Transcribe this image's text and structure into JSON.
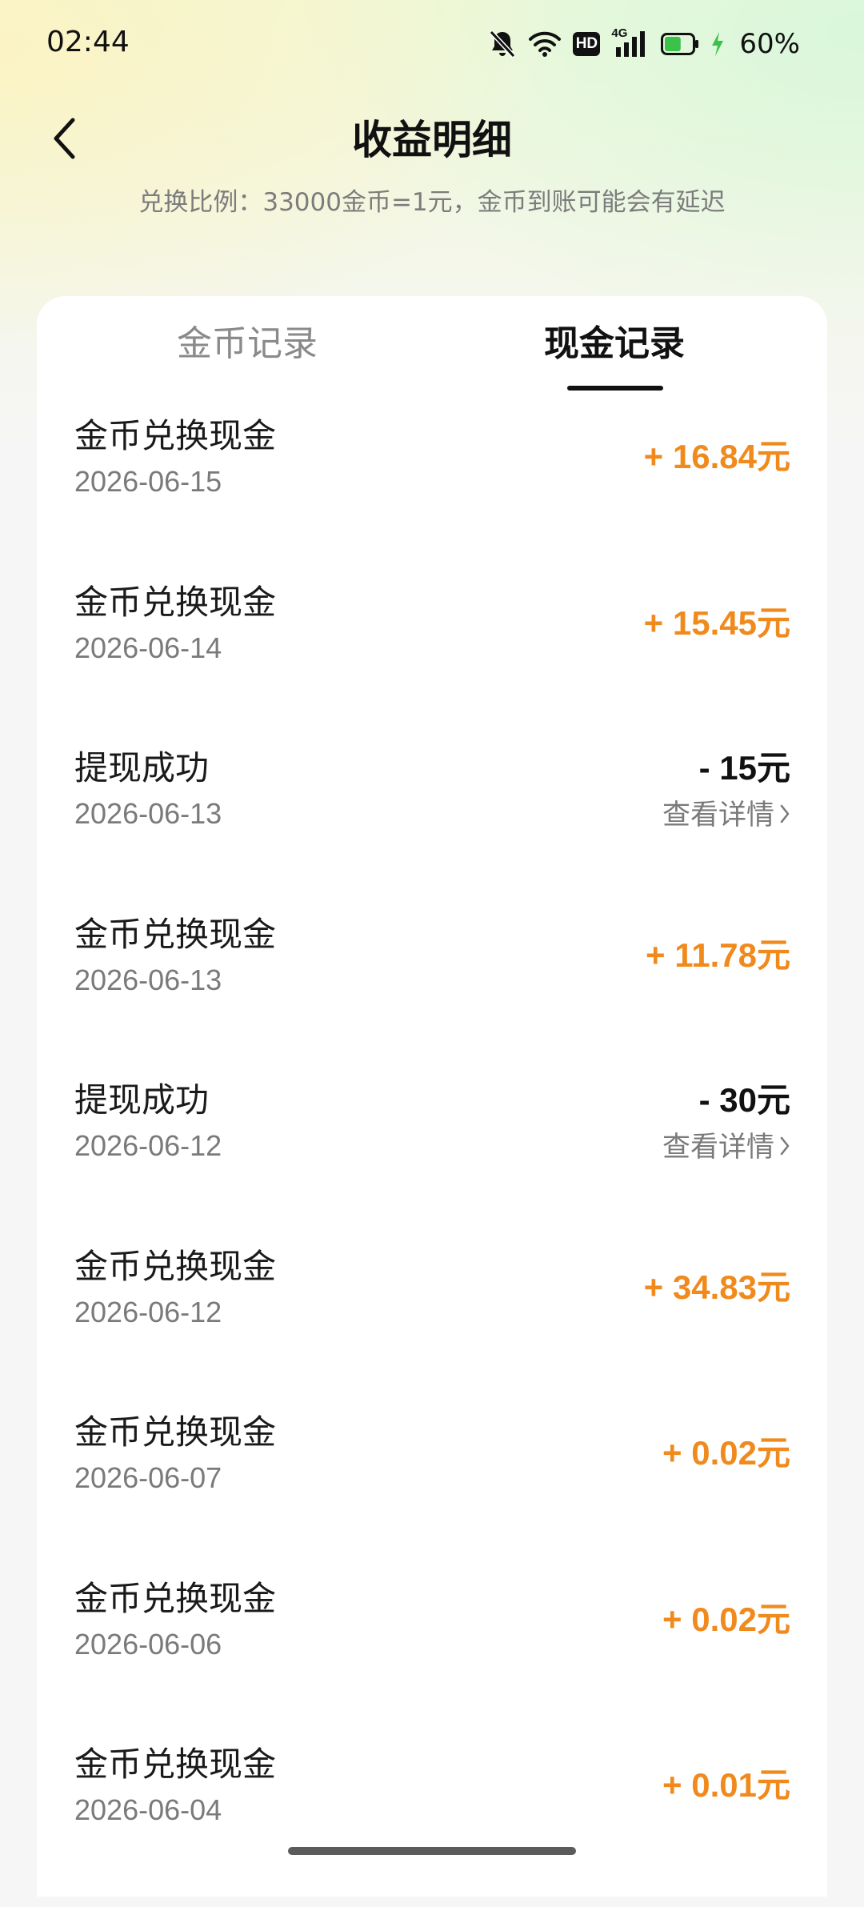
{
  "status_bar": {
    "time": "02:44",
    "network": "4G",
    "hd": "HD",
    "battery_percent": "60%",
    "battery_level": 0.6
  },
  "header": {
    "title": "收益明细",
    "subtitle": "兑换比例：33000金币=1元，金币到账可能会有延迟"
  },
  "tabs": [
    {
      "label": "金币记录",
      "active": false
    },
    {
      "label": "现金记录",
      "active": true
    }
  ],
  "records": [
    {
      "title": "金币兑换现金",
      "date": "2026-06-15",
      "amount": "+ 16.84",
      "unit": "元",
      "type": "income"
    },
    {
      "title": "金币兑换现金",
      "date": "2026-06-14",
      "amount": "+ 15.45",
      "unit": "元",
      "type": "income"
    },
    {
      "title": "提现成功",
      "date": "2026-06-13",
      "amount": "- 15",
      "unit": "元",
      "type": "withdraw",
      "detail": "查看详情"
    },
    {
      "title": "金币兑换现金",
      "date": "2026-06-13",
      "amount": "+ 11.78",
      "unit": "元",
      "type": "income"
    },
    {
      "title": "提现成功",
      "date": "2026-06-12",
      "amount": "- 30",
      "unit": "元",
      "type": "withdraw",
      "detail": "查看详情"
    },
    {
      "title": "金币兑换现金",
      "date": "2026-06-12",
      "amount": "+ 34.83",
      "unit": "元",
      "type": "income"
    },
    {
      "title": "金币兑换现金",
      "date": "2026-06-07",
      "amount": "+ 0.02",
      "unit": "元",
      "type": "income"
    },
    {
      "title": "金币兑换现金",
      "date": "2026-06-06",
      "amount": "+ 0.02",
      "unit": "元",
      "type": "income"
    },
    {
      "title": "金币兑换现金",
      "date": "2026-06-04",
      "amount": "+ 0.01",
      "unit": "元",
      "type": "income"
    }
  ],
  "colors": {
    "income": "#f08a1c",
    "withdraw": "#111111",
    "battery_fill": "#3cc24a"
  }
}
